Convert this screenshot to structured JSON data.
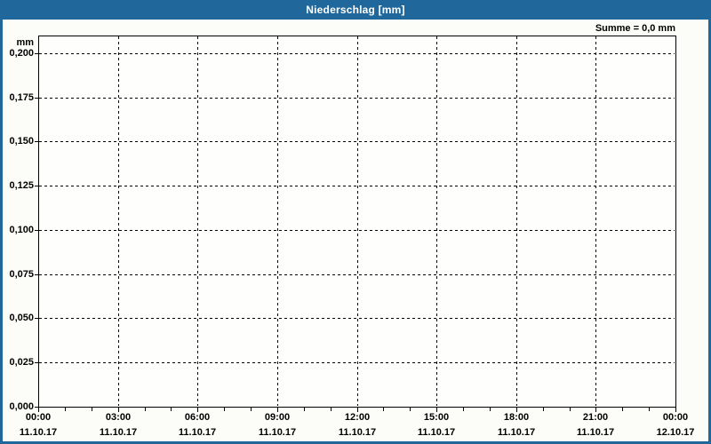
{
  "window": {
    "title": "Niederschlag [mm]"
  },
  "colors": {
    "titlebar": "#20689c",
    "window_border": "#20689c",
    "background": "#fcfcf9",
    "plot_background": "#fefefc",
    "grid": "#000000",
    "text": "#000000",
    "title_text": "#ffffff"
  },
  "chart_data": {
    "type": "line",
    "title": "Niederschlag [mm]",
    "ylabel": "mm",
    "annotation": "Summe = 0,0 mm",
    "grid": "dashed",
    "legend": "none",
    "ylim": [
      0,
      0.21
    ],
    "y_tick_values": [
      0,
      0.025,
      0.05,
      0.075,
      0.1,
      0.125,
      0.15,
      0.175,
      0.2
    ],
    "y_tick_labels": [
      "0,000",
      "0,025",
      "0,050",
      "0,075",
      "0,100",
      "0,125",
      "0,150",
      "0,175",
      "0,200"
    ],
    "x_range_hours": [
      0,
      24
    ],
    "x_major_hours": [
      0,
      3,
      6,
      9,
      12,
      15,
      18,
      21,
      24
    ],
    "x_minor_step_hours": 1,
    "x_tick_labels": [
      {
        "time": "00:00",
        "date": "11.10.17"
      },
      {
        "time": "03:00",
        "date": "11.10.17"
      },
      {
        "time": "06:00",
        "date": "11.10.17"
      },
      {
        "time": "09:00",
        "date": "11.10.17"
      },
      {
        "time": "12:00",
        "date": "11.10.17"
      },
      {
        "time": "15:00",
        "date": "11.10.17"
      },
      {
        "time": "18:00",
        "date": "11.10.17"
      },
      {
        "time": "21:00",
        "date": "11.10.17"
      }
    ],
    "x_end_label": {
      "time": "00:00",
      "date": "12.10.17"
    },
    "series": [
      {
        "name": "Niederschlag",
        "values": []
      }
    ]
  }
}
